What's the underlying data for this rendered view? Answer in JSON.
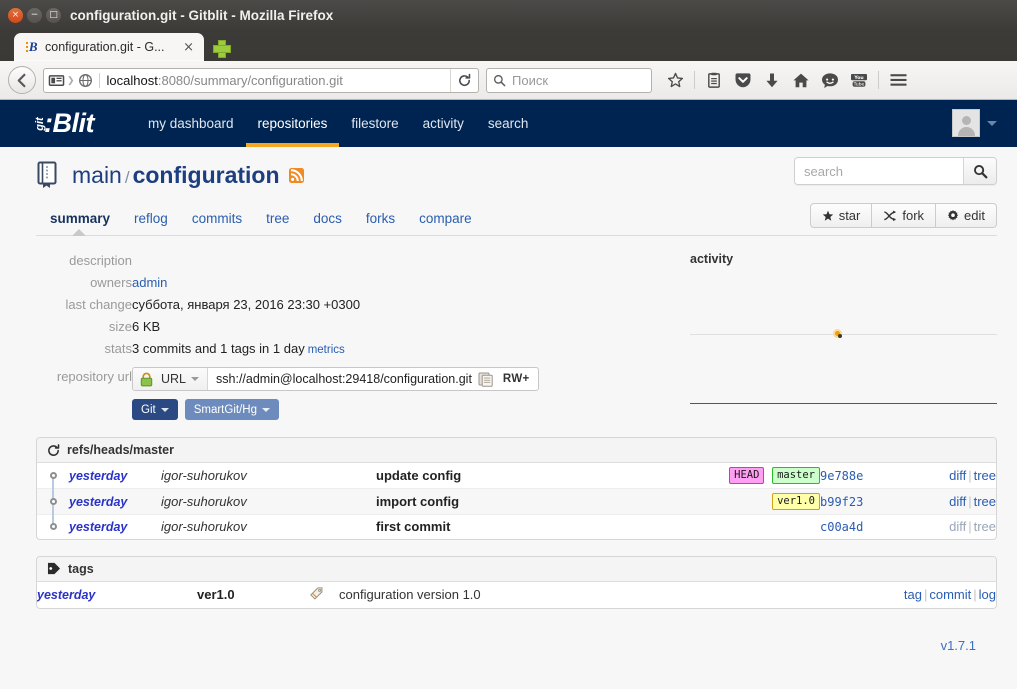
{
  "window": {
    "title": "configuration.git - Gitblit - Mozilla Firefox",
    "close_glyph": "×",
    "minimize_glyph": "−",
    "maximize_glyph": "□"
  },
  "browser": {
    "tab_label": "configuration.git - G...",
    "tab_close_glyph": "×",
    "url_host": "localhost",
    "url_path": ":8080/summary/configuration.git",
    "search_placeholder": "Поиск",
    "toolbar_icons": [
      "star-icon",
      "reader-icon",
      "pocket-icon",
      "downloads-icon",
      "home-icon",
      "chat-icon",
      "youtube-icon",
      "menu-icon"
    ]
  },
  "gitblit_nav": {
    "logo_git": "git",
    "logo_rest": ":Blit",
    "items": [
      {
        "label": "my dashboard",
        "active": false
      },
      {
        "label": "repositories",
        "active": true
      },
      {
        "label": "filestore",
        "active": false
      },
      {
        "label": "activity",
        "active": false
      },
      {
        "label": "search",
        "active": false
      }
    ]
  },
  "repo": {
    "project": "main",
    "separator": "/",
    "name": "configuration",
    "search_placeholder": "search",
    "tabs": [
      {
        "label": "summary",
        "active": true
      },
      {
        "label": "reflog",
        "active": false
      },
      {
        "label": "commits",
        "active": false
      },
      {
        "label": "tree",
        "active": false
      },
      {
        "label": "docs",
        "active": false
      },
      {
        "label": "forks",
        "active": false
      },
      {
        "label": "compare",
        "active": false
      }
    ],
    "actions": [
      {
        "label": "star",
        "icon": "star-icon"
      },
      {
        "label": "fork",
        "icon": "fork-icon"
      },
      {
        "label": "edit",
        "icon": "gear-icon"
      }
    ]
  },
  "summary": {
    "labels": {
      "description": "description",
      "owners": "owners",
      "last_change": "last change",
      "size": "size",
      "stats": "stats",
      "repository_url": "repository url"
    },
    "description": "",
    "owners": "admin",
    "last_change": "суббота, января 23, 2016 23:30 +0300",
    "size": "6 KB",
    "stats": "3 commits and 1 tags in 1 day",
    "metrics_link": "metrics",
    "url_kind": "URL",
    "url_value": "ssh://admin@localhost:29418/configuration.git",
    "url_permission": "RW+",
    "clients": [
      {
        "label": "Git",
        "style": "primary"
      },
      {
        "label": "SmartGit/Hg",
        "style": "secondary"
      }
    ]
  },
  "activity": {
    "title": "activity"
  },
  "chart_data": {
    "type": "scatter",
    "title": "activity",
    "x": [
      0.485
    ],
    "y": [
      1
    ],
    "categories": [
      "2016-01-23"
    ],
    "values": [
      3
    ],
    "xlabel": "",
    "ylabel": "",
    "grid": false,
    "legend": false,
    "point_color": "#f5a000",
    "line_color": "#e0e0e0",
    "axis_color": "#555555"
  },
  "commits_panel": {
    "icon": "refresh-icon",
    "title": "refs/heads/master",
    "rows": [
      {
        "date": "yesterday",
        "author": "igor-suhorukov",
        "message": "update config",
        "badges": [
          {
            "text": "HEAD",
            "type": "head"
          },
          {
            "text": "master",
            "type": "branch"
          }
        ],
        "hash": "9e788e",
        "links": [
          {
            "label": "diff",
            "muted": false
          },
          {
            "label": "tree",
            "muted": false
          }
        ]
      },
      {
        "date": "yesterday",
        "author": "igor-suhorukov",
        "message": "import config",
        "badges": [
          {
            "text": "ver1.0",
            "type": "tag"
          }
        ],
        "hash": "b99f23",
        "links": [
          {
            "label": "diff",
            "muted": false
          },
          {
            "label": "tree",
            "muted": false
          }
        ]
      },
      {
        "date": "yesterday",
        "author": "igor-suhorukov",
        "message": "first commit",
        "badges": [],
        "hash": "c00a4d",
        "links": [
          {
            "label": "diff",
            "muted": true
          },
          {
            "label": "tree",
            "muted": true
          }
        ]
      }
    ]
  },
  "tags_panel": {
    "icon": "tag-icon",
    "title": "tags",
    "rows": [
      {
        "date": "yesterday",
        "name": "ver1.0",
        "message": "configuration version 1.0",
        "links": [
          "tag",
          "commit",
          "log"
        ]
      }
    ]
  },
  "footer": {
    "version": "v1.7.1"
  }
}
